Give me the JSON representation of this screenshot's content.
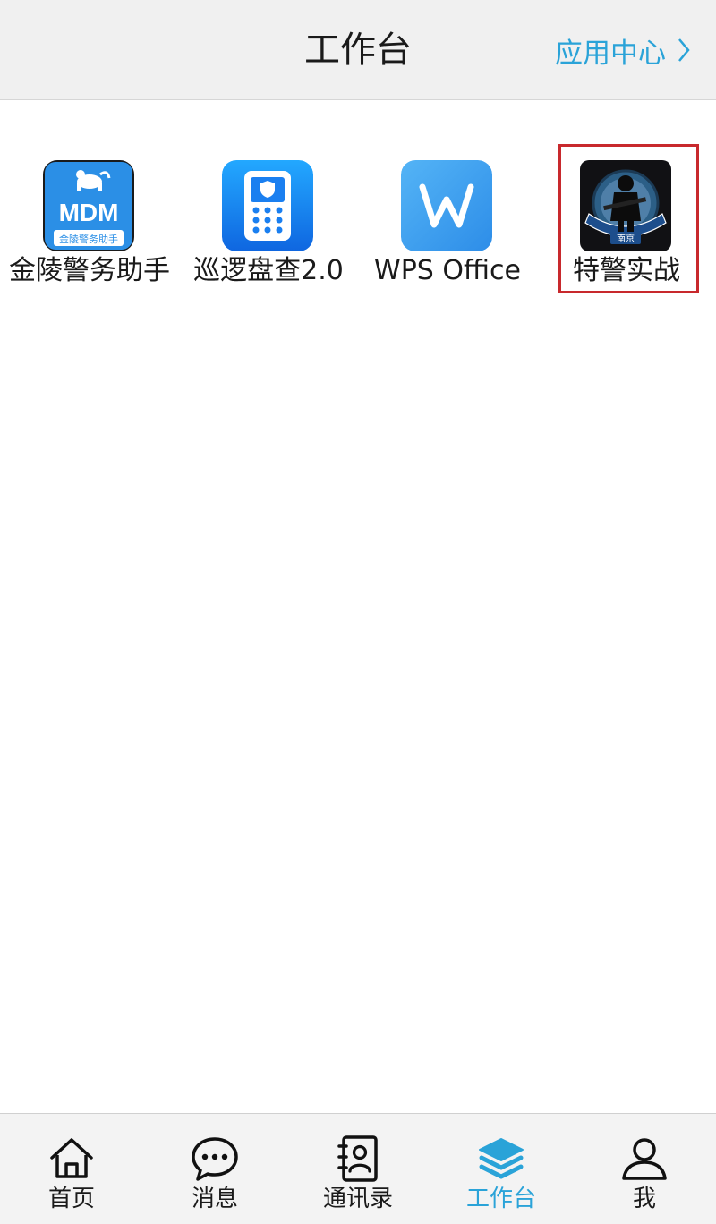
{
  "header": {
    "title": "工作台",
    "app_center_label": "应用中心",
    "app_center_icon": "chevron-right-icon"
  },
  "apps": [
    {
      "label": "金陵警务助手",
      "icon": "mdm-app-icon",
      "icon_text": "MDM",
      "icon_subtext": "金陵警务助手",
      "color": "#2b8fe6"
    },
    {
      "label": "巡逻盘查2.0",
      "icon": "police-device-app-icon",
      "color": "#1a7ff0"
    },
    {
      "label": "WPS Office",
      "icon": "wps-app-icon",
      "color": "#3f9ff0"
    },
    {
      "label": "特警实战",
      "icon": "swat-emblem-app-icon",
      "icon_text": "南京",
      "selected": true,
      "color": "#16161a"
    }
  ],
  "tabbar": {
    "accent": "#2aa3d8",
    "items": [
      {
        "label": "首页",
        "icon": "home-icon",
        "active": false
      },
      {
        "label": "消息",
        "icon": "chat-bubble-icon",
        "active": false
      },
      {
        "label": "通讯录",
        "icon": "contacts-book-icon",
        "active": false
      },
      {
        "label": "工作台",
        "icon": "layers-icon",
        "active": true
      },
      {
        "label": "我",
        "icon": "user-icon",
        "active": false
      }
    ]
  }
}
